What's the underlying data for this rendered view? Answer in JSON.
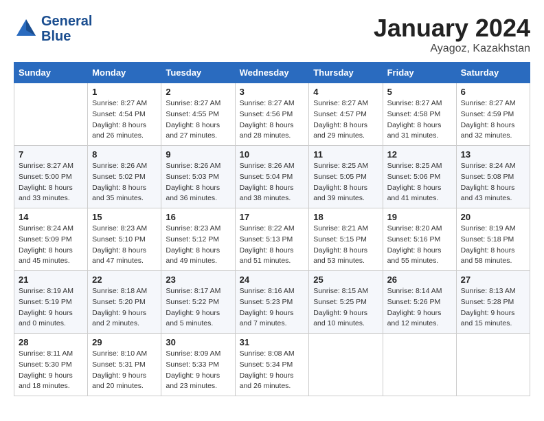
{
  "header": {
    "logo_line1": "General",
    "logo_line2": "Blue",
    "month": "January 2024",
    "location": "Ayagoz, Kazakhstan"
  },
  "weekdays": [
    "Sunday",
    "Monday",
    "Tuesday",
    "Wednesday",
    "Thursday",
    "Friday",
    "Saturday"
  ],
  "weeks": [
    [
      {
        "day": "",
        "info": ""
      },
      {
        "day": "1",
        "info": "Sunrise: 8:27 AM\nSunset: 4:54 PM\nDaylight: 8 hours\nand 26 minutes."
      },
      {
        "day": "2",
        "info": "Sunrise: 8:27 AM\nSunset: 4:55 PM\nDaylight: 8 hours\nand 27 minutes."
      },
      {
        "day": "3",
        "info": "Sunrise: 8:27 AM\nSunset: 4:56 PM\nDaylight: 8 hours\nand 28 minutes."
      },
      {
        "day": "4",
        "info": "Sunrise: 8:27 AM\nSunset: 4:57 PM\nDaylight: 8 hours\nand 29 minutes."
      },
      {
        "day": "5",
        "info": "Sunrise: 8:27 AM\nSunset: 4:58 PM\nDaylight: 8 hours\nand 31 minutes."
      },
      {
        "day": "6",
        "info": "Sunrise: 8:27 AM\nSunset: 4:59 PM\nDaylight: 8 hours\nand 32 minutes."
      }
    ],
    [
      {
        "day": "7",
        "info": "Sunrise: 8:27 AM\nSunset: 5:00 PM\nDaylight: 8 hours\nand 33 minutes."
      },
      {
        "day": "8",
        "info": "Sunrise: 8:26 AM\nSunset: 5:02 PM\nDaylight: 8 hours\nand 35 minutes."
      },
      {
        "day": "9",
        "info": "Sunrise: 8:26 AM\nSunset: 5:03 PM\nDaylight: 8 hours\nand 36 minutes."
      },
      {
        "day": "10",
        "info": "Sunrise: 8:26 AM\nSunset: 5:04 PM\nDaylight: 8 hours\nand 38 minutes."
      },
      {
        "day": "11",
        "info": "Sunrise: 8:25 AM\nSunset: 5:05 PM\nDaylight: 8 hours\nand 39 minutes."
      },
      {
        "day": "12",
        "info": "Sunrise: 8:25 AM\nSunset: 5:06 PM\nDaylight: 8 hours\nand 41 minutes."
      },
      {
        "day": "13",
        "info": "Sunrise: 8:24 AM\nSunset: 5:08 PM\nDaylight: 8 hours\nand 43 minutes."
      }
    ],
    [
      {
        "day": "14",
        "info": "Sunrise: 8:24 AM\nSunset: 5:09 PM\nDaylight: 8 hours\nand 45 minutes."
      },
      {
        "day": "15",
        "info": "Sunrise: 8:23 AM\nSunset: 5:10 PM\nDaylight: 8 hours\nand 47 minutes."
      },
      {
        "day": "16",
        "info": "Sunrise: 8:23 AM\nSunset: 5:12 PM\nDaylight: 8 hours\nand 49 minutes."
      },
      {
        "day": "17",
        "info": "Sunrise: 8:22 AM\nSunset: 5:13 PM\nDaylight: 8 hours\nand 51 minutes."
      },
      {
        "day": "18",
        "info": "Sunrise: 8:21 AM\nSunset: 5:15 PM\nDaylight: 8 hours\nand 53 minutes."
      },
      {
        "day": "19",
        "info": "Sunrise: 8:20 AM\nSunset: 5:16 PM\nDaylight: 8 hours\nand 55 minutes."
      },
      {
        "day": "20",
        "info": "Sunrise: 8:19 AM\nSunset: 5:18 PM\nDaylight: 8 hours\nand 58 minutes."
      }
    ],
    [
      {
        "day": "21",
        "info": "Sunrise: 8:19 AM\nSunset: 5:19 PM\nDaylight: 9 hours\nand 0 minutes."
      },
      {
        "day": "22",
        "info": "Sunrise: 8:18 AM\nSunset: 5:20 PM\nDaylight: 9 hours\nand 2 minutes."
      },
      {
        "day": "23",
        "info": "Sunrise: 8:17 AM\nSunset: 5:22 PM\nDaylight: 9 hours\nand 5 minutes."
      },
      {
        "day": "24",
        "info": "Sunrise: 8:16 AM\nSunset: 5:23 PM\nDaylight: 9 hours\nand 7 minutes."
      },
      {
        "day": "25",
        "info": "Sunrise: 8:15 AM\nSunset: 5:25 PM\nDaylight: 9 hours\nand 10 minutes."
      },
      {
        "day": "26",
        "info": "Sunrise: 8:14 AM\nSunset: 5:26 PM\nDaylight: 9 hours\nand 12 minutes."
      },
      {
        "day": "27",
        "info": "Sunrise: 8:13 AM\nSunset: 5:28 PM\nDaylight: 9 hours\nand 15 minutes."
      }
    ],
    [
      {
        "day": "28",
        "info": "Sunrise: 8:11 AM\nSunset: 5:30 PM\nDaylight: 9 hours\nand 18 minutes."
      },
      {
        "day": "29",
        "info": "Sunrise: 8:10 AM\nSunset: 5:31 PM\nDaylight: 9 hours\nand 20 minutes."
      },
      {
        "day": "30",
        "info": "Sunrise: 8:09 AM\nSunset: 5:33 PM\nDaylight: 9 hours\nand 23 minutes."
      },
      {
        "day": "31",
        "info": "Sunrise: 8:08 AM\nSunset: 5:34 PM\nDaylight: 9 hours\nand 26 minutes."
      },
      {
        "day": "",
        "info": ""
      },
      {
        "day": "",
        "info": ""
      },
      {
        "day": "",
        "info": ""
      }
    ]
  ]
}
